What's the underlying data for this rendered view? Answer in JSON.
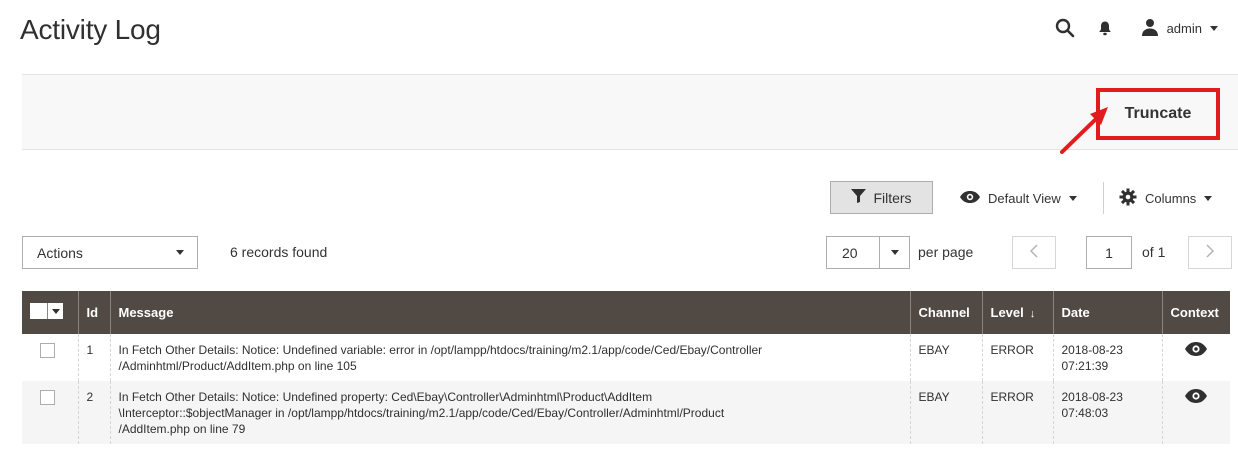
{
  "header": {
    "title": "Activity Log",
    "user": "admin"
  },
  "page_actions": {
    "truncate_label": "Truncate"
  },
  "toolbar": {
    "filters_label": "Filters",
    "view_label": "Default View",
    "columns_label": "Columns"
  },
  "grid_controls": {
    "actions_label": "Actions",
    "records_found": "6 records found",
    "per_page_value": "20",
    "per_page_label": "per page",
    "current_page": "1",
    "of_pages": "of 1"
  },
  "table": {
    "columns": [
      "Id",
      "Message",
      "Channel",
      "Level",
      "Date",
      "Context"
    ],
    "sort_indicator": "↓",
    "rows": [
      {
        "id": "1",
        "message": "In Fetch Other Details: Notice: Undefined variable: error in /opt/lampp/htdocs/training/m2.1/app/code/Ced/Ebay/Controller\n/Adminhtml/Product/AddItem.php on line 105",
        "channel": "EBAY",
        "level": "ERROR",
        "date": "2018-08-23\n07:21:39"
      },
      {
        "id": "2",
        "message": "In Fetch Other Details: Notice: Undefined property: Ced\\Ebay\\Controller\\Adminhtml\\Product\\AddItem\n\\Interceptor::$objectManager in /opt/lampp/htdocs/training/m2.1/app/code/Ced/Ebay/Controller/Adminhtml/Product\n/AddItem.php on line 79",
        "channel": "EBAY",
        "level": "ERROR",
        "date": "2018-08-23\n07:48:03"
      }
    ]
  },
  "icons": {
    "search": "search-icon",
    "bell": "bell-icon",
    "user": "user-icon",
    "filter": "funnel-icon",
    "eye": "eye-icon",
    "gear": "gear-icon"
  },
  "colors": {
    "header_bg": "#514943",
    "highlight": "#e21c1c",
    "panel_bg": "#f8f8f8"
  }
}
